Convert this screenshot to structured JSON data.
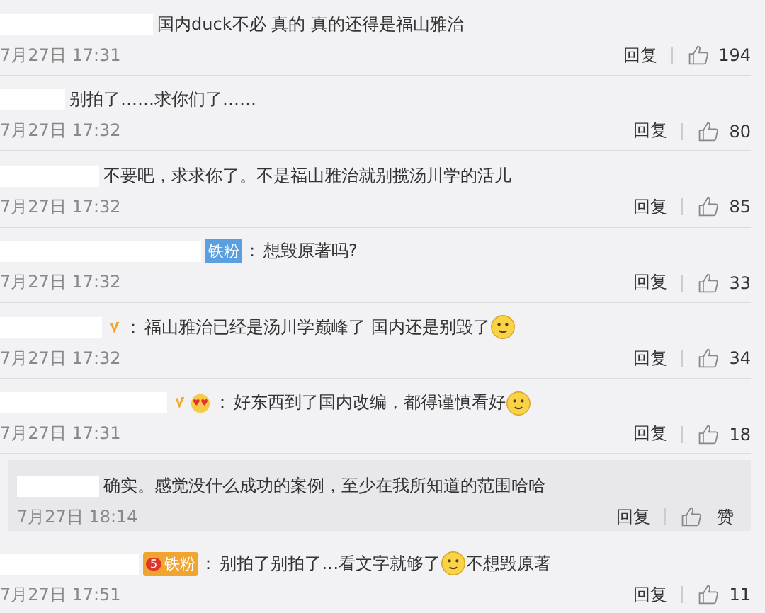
{
  "comments": [
    {
      "kind": "comment",
      "segments": [
        {
          "kind": "text",
          "text": "国内duck不必 真的 真的还得是福山雅治"
        }
      ],
      "time": "7月27日 17:31",
      "reply": "回复",
      "likes": "194"
    },
    {
      "kind": "comment",
      "segments": [
        {
          "kind": "text",
          "text": "别拍了……求你们了……"
        }
      ],
      "time": "7月27日 17:32",
      "reply": "回复",
      "likes": "80"
    },
    {
      "kind": "comment",
      "segments": [
        {
          "kind": "text",
          "text": "不要吧，求求你了。不是福山雅治就别揽汤川学的活儿"
        }
      ],
      "time": "7月27日 17:32",
      "reply": "回复",
      "likes": "85"
    },
    {
      "kind": "comment",
      "badge": {
        "kind": "blue",
        "text": "铁粉"
      },
      "colon": "：",
      "segments": [
        {
          "kind": "text",
          "text": "想毁原著吗?"
        }
      ],
      "time": "7月27日 17:32",
      "reply": "回复",
      "likes": "33"
    },
    {
      "kind": "comment",
      "marks": [
        {
          "kind": "verified"
        }
      ],
      "colon": "：",
      "segments": [
        {
          "kind": "text",
          "text": "福山雅治已经是汤川学巅峰了 国内还是别毁了"
        },
        {
          "kind": "emoji"
        }
      ],
      "time": "7月27日 17:32",
      "reply": "回复",
      "likes": "34"
    },
    {
      "kind": "comment",
      "marks": [
        {
          "kind": "verified"
        },
        {
          "kind": "heart"
        }
      ],
      "colon": "：",
      "segments": [
        {
          "kind": "text",
          "text": "好东西到了国内改编，都得谨慎看好"
        },
        {
          "kind": "emoji"
        }
      ],
      "time": "7月27日 17:31",
      "reply": "回复",
      "likes": "18"
    },
    {
      "kind": "reply",
      "segments": [
        {
          "kind": "text",
          "text": "确实。感觉没什么成功的案例，至少在我所知道的范围哈哈"
        }
      ],
      "time": "7月27日 18:14",
      "reply": "回复",
      "likes": "赞"
    },
    {
      "kind": "comment",
      "badge": {
        "kind": "gold",
        "level": "5",
        "text": "铁粉"
      },
      "colon": "：",
      "segments": [
        {
          "kind": "text",
          "text": "别拍了别拍了…看文字就够了"
        },
        {
          "kind": "emoji"
        },
        {
          "kind": "text",
          "text": "不想毁原著"
        }
      ],
      "time": "7月27日 17:51",
      "reply": "回复",
      "likes": "11"
    }
  ]
}
